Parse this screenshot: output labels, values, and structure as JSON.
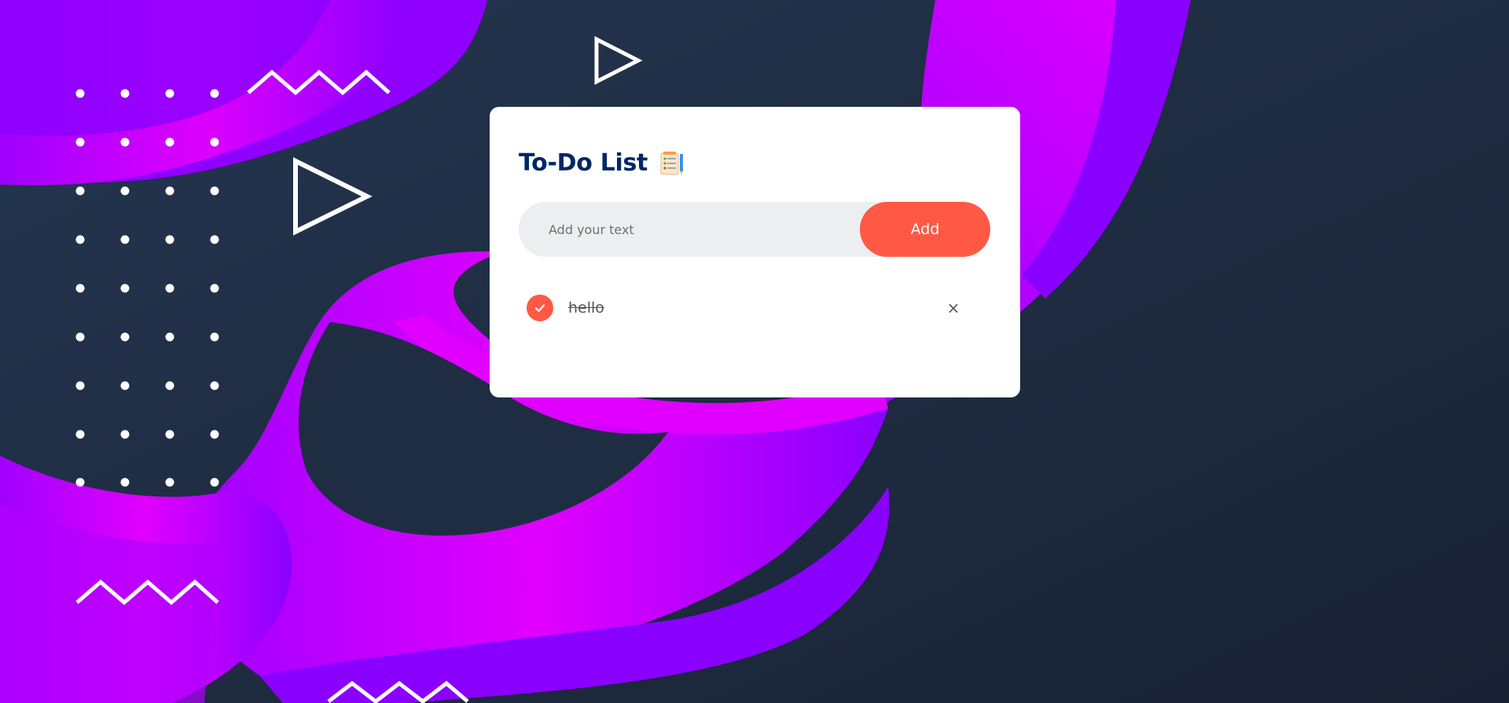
{
  "app": {
    "title": "To-Do List",
    "title_icon": "checklist-notepad-icon"
  },
  "input": {
    "placeholder": "Add your text",
    "value": ""
  },
  "add_button": {
    "label": "Add"
  },
  "tasks": [
    {
      "text": "hello",
      "checked": true,
      "delete_icon": "close-icon",
      "delete_glyph": "×"
    }
  ],
  "colors": {
    "accent": "#ff5945",
    "title": "#002765",
    "card": "#ffffff",
    "input_bg": "#edeef0",
    "bg_dark": "#1e2b3e",
    "bg_magenta": "#e100ff",
    "bg_violet": "#7f00ff"
  },
  "background": {
    "decorations": [
      "dot-grid",
      "zigzag-line",
      "triangle-outline",
      "fluid-waves"
    ]
  }
}
